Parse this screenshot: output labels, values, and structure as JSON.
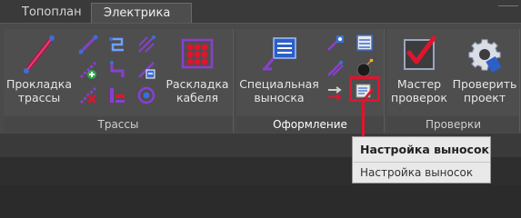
{
  "tabs": [
    {
      "label": "Топоплан",
      "active": false
    },
    {
      "label": "Электрика",
      "active": true
    }
  ],
  "groups": {
    "trassy": {
      "title": "Трассы",
      "prokladka_line1": "Прокладка",
      "prokladka_line2": "трассы",
      "raskladka_line1": "Раскладка",
      "raskladka_line2": "кабеля"
    },
    "oformlenie": {
      "title": "Оформление",
      "special_line1": "Специальная",
      "special_line2": "выноска"
    },
    "proverki": {
      "title": "Проверки",
      "master_line1": "Мастер",
      "master_line2": "проверок",
      "check_line1": "Проверить",
      "check_line2": "проект"
    }
  },
  "tooltip": {
    "title": "Настройка выносок",
    "description": "Настройка выносок"
  },
  "colors": {
    "accent_red": "#e0142e",
    "icon_purple": "#8a3fd0",
    "icon_green": "#2fa84f",
    "icon_blue": "#3a6fd8"
  }
}
